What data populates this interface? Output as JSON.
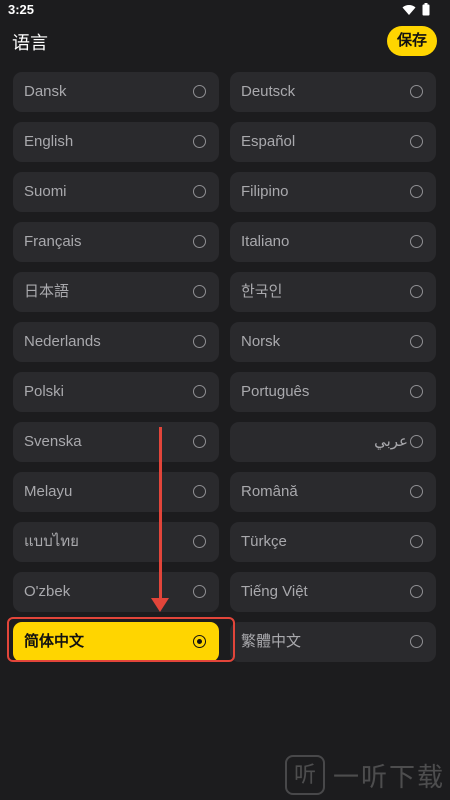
{
  "status": {
    "time": "3:25"
  },
  "header": {
    "title": "语言",
    "save_label": "保存"
  },
  "languages": [
    {
      "label": "Dansk"
    },
    {
      "label": "Deutsck"
    },
    {
      "label": "English"
    },
    {
      "label": "Español"
    },
    {
      "label": "Suomi"
    },
    {
      "label": "Filipino"
    },
    {
      "label": "Français"
    },
    {
      "label": "Italiano"
    },
    {
      "label": "日本語"
    },
    {
      "label": "한국인"
    },
    {
      "label": "Nederlands"
    },
    {
      "label": "Norsk"
    },
    {
      "label": "Polski"
    },
    {
      "label": "Português"
    },
    {
      "label": "Svenska"
    },
    {
      "label": "عربي"
    },
    {
      "label": "Melayu"
    },
    {
      "label": "Română"
    },
    {
      "label": "แบบไทย"
    },
    {
      "label": "Türkçe"
    },
    {
      "label": "O'zbek"
    },
    {
      "label": "Tiếng Việt"
    },
    {
      "label": "简体中文"
    },
    {
      "label": "繁體中文"
    }
  ],
  "selected_language": "简体中文",
  "colors": {
    "accent": "#ffd500",
    "background": "#1c1c1e",
    "item": "#2a2a2d",
    "annotation": "#e2453a"
  },
  "watermark": {
    "text": "一听下载",
    "logo": "听"
  }
}
